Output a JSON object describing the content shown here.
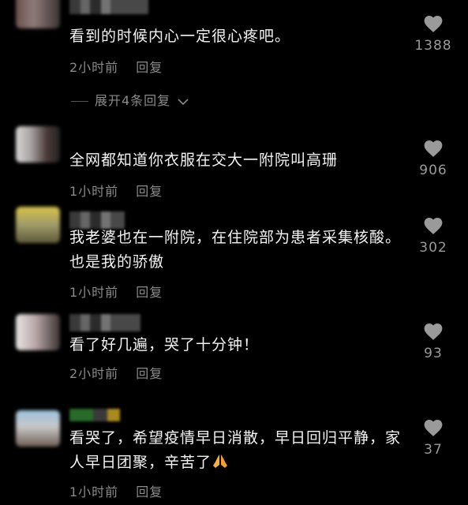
{
  "comments": [
    {
      "text": "看到的时候内心一定很心疼吧。",
      "time": "2小时前",
      "reply": "回复",
      "likes": "1388"
    },
    {
      "text": "全网都知道你衣服在交大一附院叫高珊",
      "time": "1小时前",
      "reply": "回复",
      "likes": "906"
    },
    {
      "text": "我老婆也在一附院，在住院部为患者采集核酸。也是我的骄傲",
      "time": "1小时前",
      "reply": "回复",
      "likes": "302"
    },
    {
      "text": "看了好几遍，哭了十分钟！",
      "time": "2小时前",
      "reply": "回复",
      "likes": "93"
    },
    {
      "text": "看哭了，希望疫情早日消散，早日回归平静，家人早日团聚，辛苦了",
      "time": "1小时前",
      "reply": "回复",
      "likes": "37"
    }
  ],
  "expand_label": "展开4条回复",
  "icons": {
    "like": "heart-icon",
    "expand": "chevron-down-icon",
    "emoji": "praying-hands-emoji"
  },
  "colors": {
    "background": "#000000",
    "text": "#f3f3f3",
    "meta": "#8a8a8a",
    "icon": "#9a9a9a"
  }
}
